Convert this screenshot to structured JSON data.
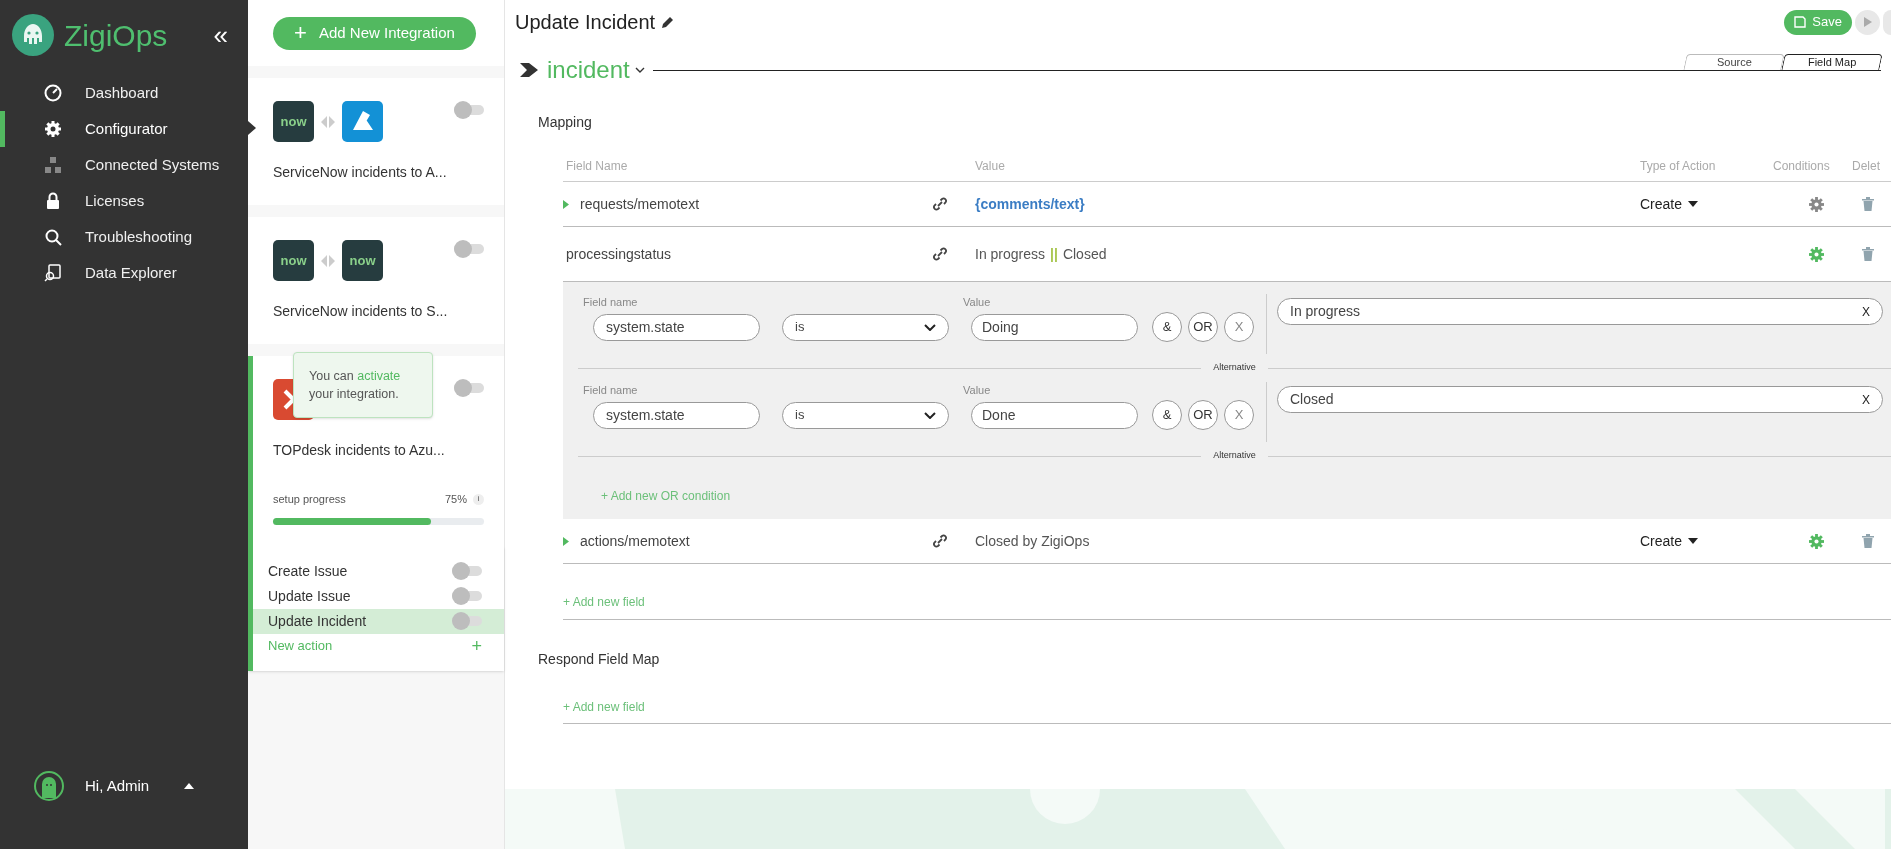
{
  "brand": {
    "name": "ZigiOps",
    "collapse": "«"
  },
  "nav": [
    {
      "label": "Dashboard",
      "selected": false
    },
    {
      "label": "Configurator",
      "selected": true
    },
    {
      "label": "Connected Systems",
      "selected": false
    },
    {
      "label": "Licenses",
      "selected": false
    },
    {
      "label": "Troubleshooting",
      "selected": false
    },
    {
      "label": "Data Explorer",
      "selected": false
    }
  ],
  "user": {
    "greeting": "Hi, Admin"
  },
  "add_integration": {
    "icon": "+",
    "label": "Add New Integration"
  },
  "integrations": [
    {
      "source": {
        "kind": "servicenow",
        "text": "now"
      },
      "target": {
        "kind": "azure"
      },
      "name": "ServiceNow incidents to A...",
      "on": false,
      "selected": false
    },
    {
      "source": {
        "kind": "servicenow",
        "text": "now"
      },
      "target": {
        "kind": "servicenow",
        "text": "now"
      },
      "name": "ServiceNow incidents to S...",
      "on": false,
      "selected": false
    },
    {
      "source": {
        "kind": "topdesk"
      },
      "name": "TOPdesk incidents to Azu...",
      "on": false,
      "selected": true,
      "tooltip": {
        "before": "You can",
        "highlight": "activate",
        "after": "your integration."
      },
      "progress": {
        "label": "setup progress",
        "percent": "75%",
        "info": "i",
        "level": 0.75
      },
      "actions": [
        {
          "label": "Create Issue",
          "on": false,
          "selected": false
        },
        {
          "label": "Update Issue",
          "on": false,
          "selected": false
        },
        {
          "label": "Update Incident",
          "on": false,
          "selected": true
        }
      ],
      "new_action": {
        "label": "New action",
        "icon": "+"
      }
    }
  ],
  "header": {
    "title": "Update Incident",
    "save": "Save"
  },
  "entity": {
    "name": "incident"
  },
  "tabs": [
    {
      "label": "Source",
      "selected": false
    },
    {
      "label": "Field Map",
      "selected": true
    }
  ],
  "mapping": {
    "title": "Mapping",
    "columns": [
      "Field Name",
      "Value",
      "Type of Action",
      "Conditions",
      "Delet"
    ],
    "rows": [
      {
        "field": "requests/memotext",
        "expanded": false,
        "value": [
          {
            "kind": "field",
            "text": "{comments/text}"
          }
        ],
        "type_of_action": "Create",
        "conditions_active": false
      },
      {
        "field": "processingstatus",
        "expanded": true,
        "value": [
          {
            "kind": "text",
            "text": "In progress"
          },
          {
            "kind": "separator",
            "text": "||"
          },
          {
            "kind": "text",
            "text": "Closed"
          }
        ],
        "conditions_active": true,
        "conditions": [
          {
            "field_label": "Field name",
            "field": "system.state",
            "operator": "is",
            "value_label": "Value",
            "value": "Doing",
            "buttons": [
              "&",
              "OR",
              "X"
            ],
            "result": "In progress",
            "clear": "X",
            "separator": "Alternative"
          },
          {
            "field_label": "Field name",
            "field": "system.state",
            "operator": "is",
            "value_label": "Value",
            "value": "Done",
            "buttons": [
              "&",
              "OR",
              "X"
            ],
            "result": "Closed",
            "clear": "X",
            "separator": "Alternative"
          }
        ],
        "add_condition": "+ Add new OR condition"
      },
      {
        "field": "actions/memotext",
        "expanded": false,
        "value": [
          {
            "kind": "text",
            "text": "Closed by ZigiOps"
          }
        ],
        "type_of_action": "Create",
        "conditions_active": true
      }
    ],
    "add_field": "+ Add new field"
  },
  "respond": {
    "title": "Respond Field Map",
    "add_field": "+ Add new field"
  }
}
